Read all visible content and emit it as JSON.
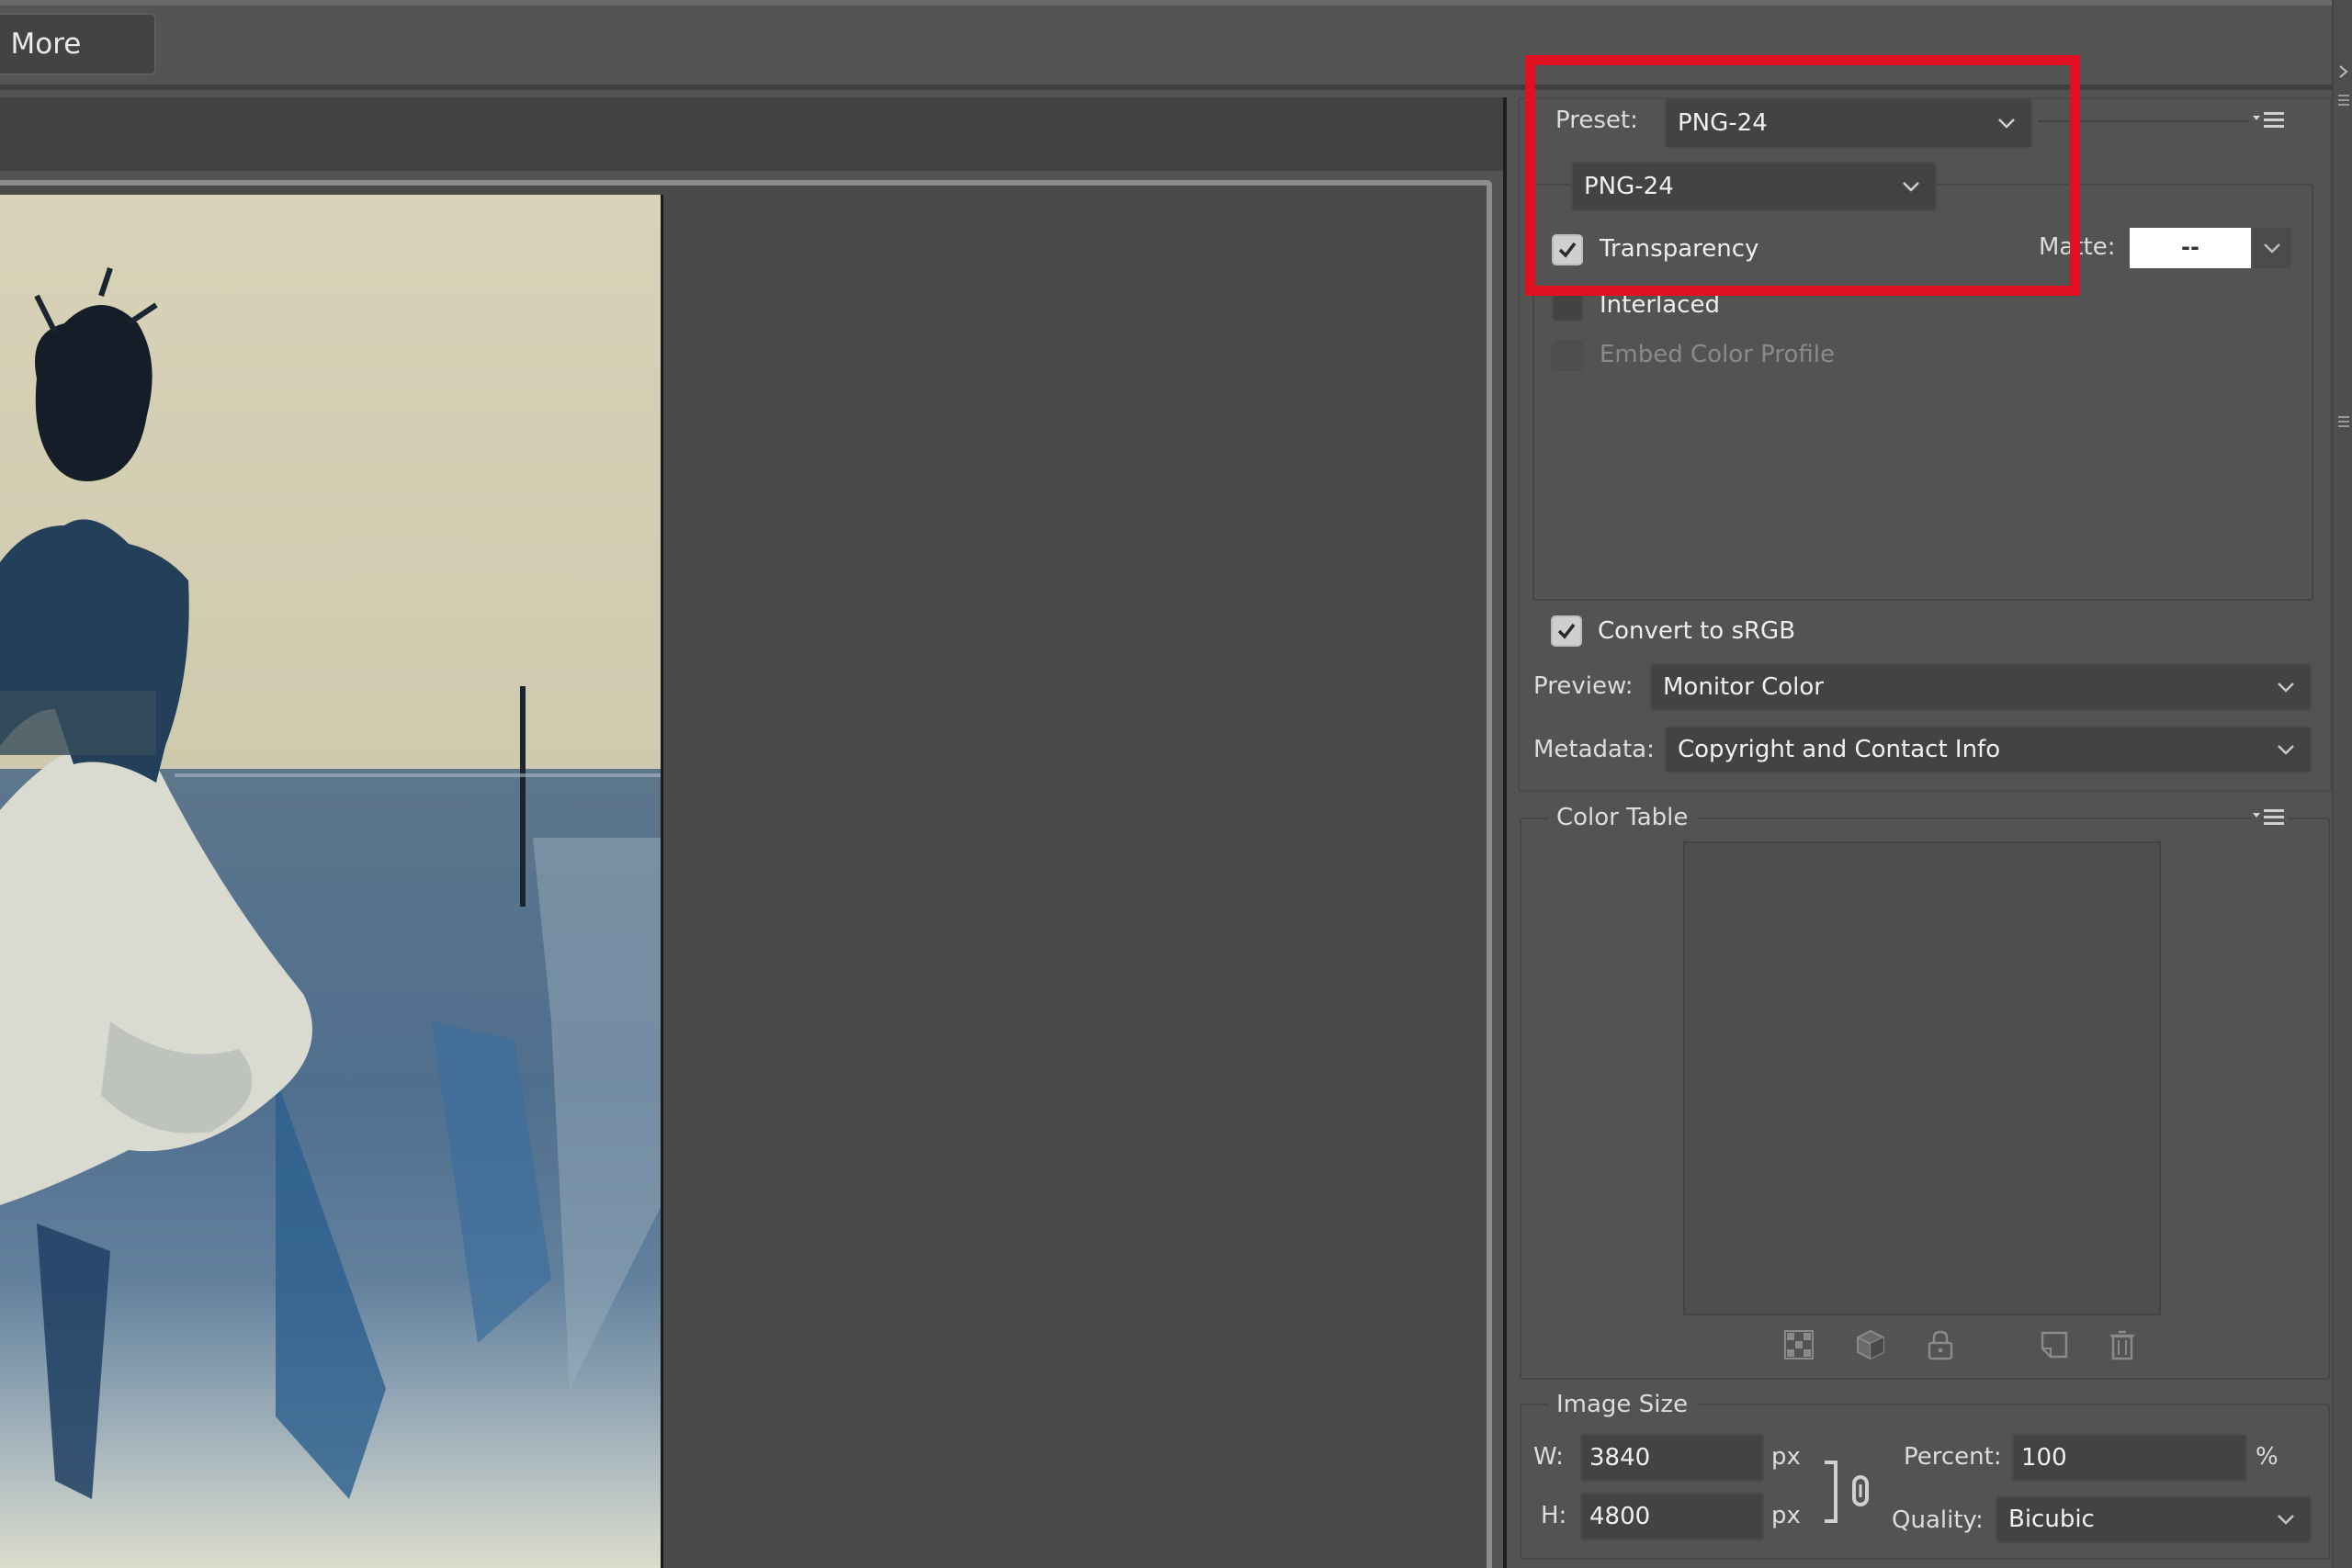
{
  "top_bar": {
    "more_button_label": "n More"
  },
  "settings": {
    "preset_label": "Preset:",
    "preset_value": "PNG-24",
    "format_value": "PNG-24",
    "transparency_label": "Transparency",
    "transparency_checked": true,
    "matte_label": "Matte:",
    "matte_value": "--",
    "interlaced_label": "Interlaced",
    "interlaced_checked": false,
    "embed_profile_label": "Embed Color Profile",
    "embed_profile_checked": false,
    "embed_profile_enabled": false,
    "convert_srgb_label": "Convert to sRGB",
    "convert_srgb_checked": true,
    "preview_label": "Preview:",
    "preview_value": "Monitor Color",
    "metadata_label": "Metadata:",
    "metadata_value": "Copyright and Contact Info"
  },
  "color_table": {
    "title": "Color Table",
    "icons": [
      "map-transparency-icon",
      "web-shift-icon",
      "lock-color-icon",
      "new-color-icon",
      "delete-color-icon"
    ]
  },
  "image_size": {
    "title": "Image Size",
    "w_label": "W:",
    "w_value": "3840",
    "h_label": "H:",
    "h_value": "4800",
    "unit": "px",
    "percent_label": "Percent:",
    "percent_value": "100",
    "percent_unit": "%",
    "quality_label": "Quality:",
    "quality_value": "Bicubic"
  },
  "annotation": {
    "highlight_color": "#e01020"
  },
  "colors": {
    "panel_bg": "#535353",
    "field_bg": "#434343",
    "text": "#e6e6e6"
  }
}
